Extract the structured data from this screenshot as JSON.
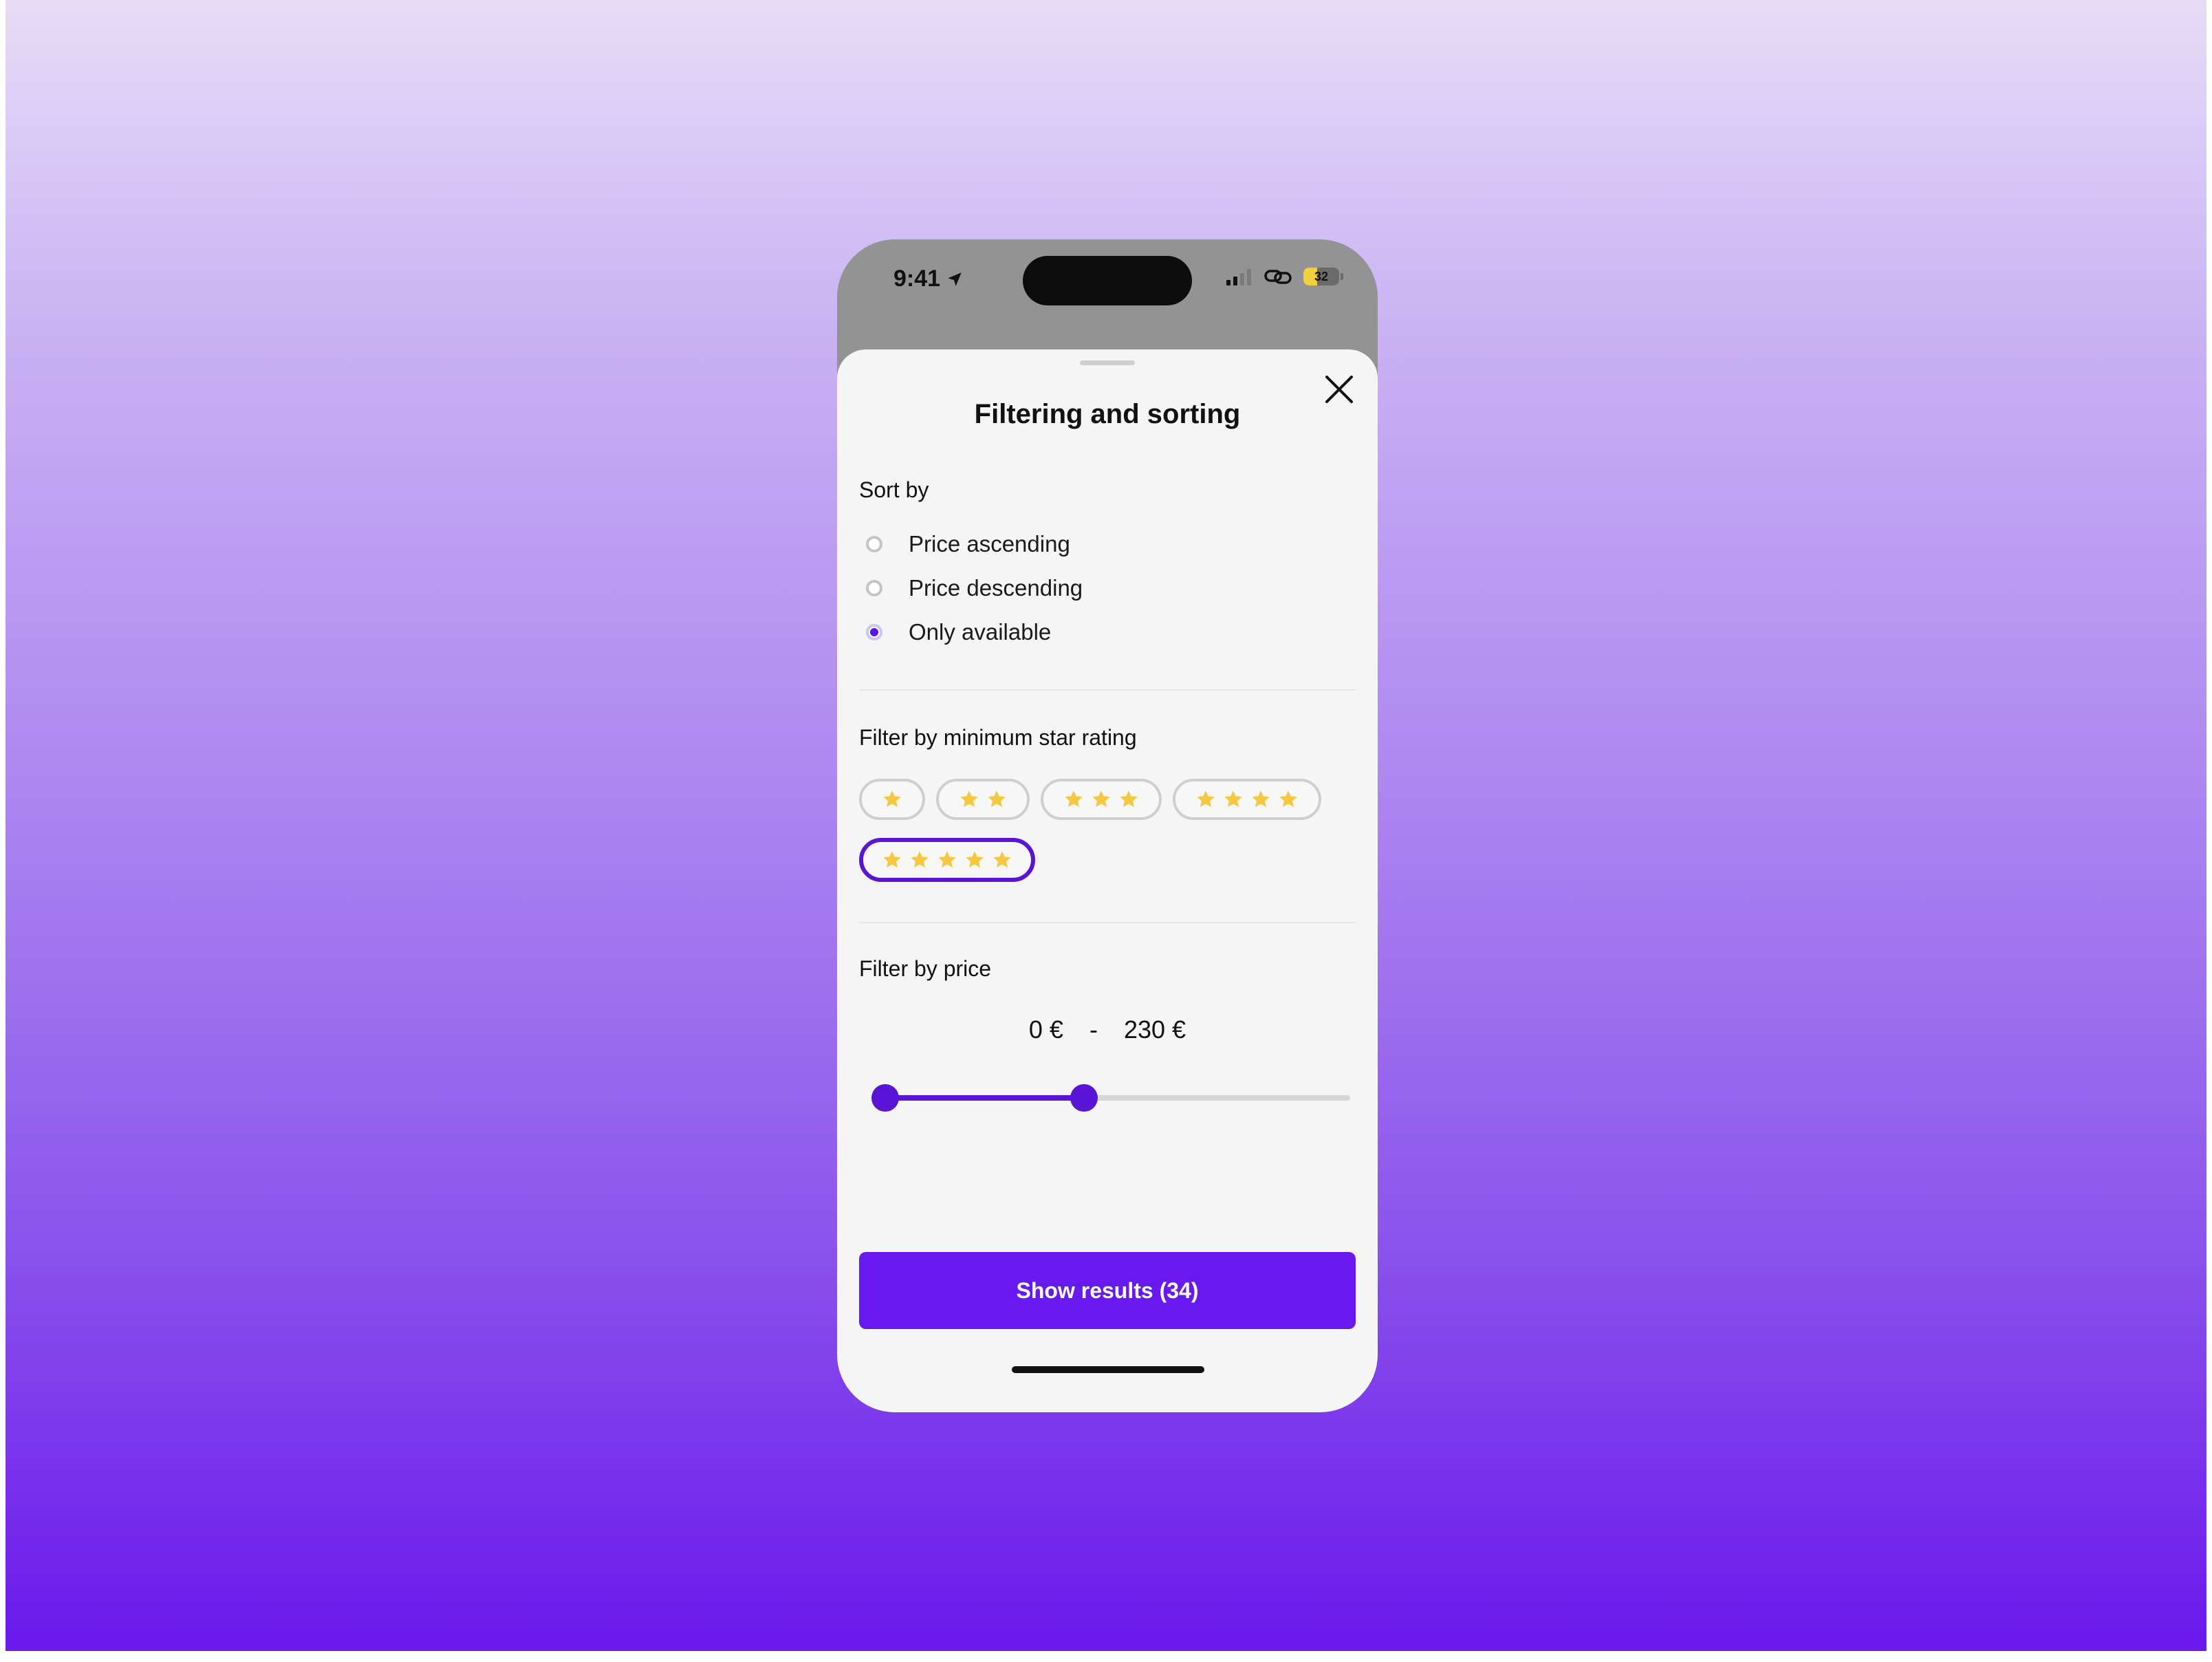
{
  "status_bar": {
    "time": "9:41",
    "battery": "32"
  },
  "sheet": {
    "title": "Filtering and sorting",
    "sort": {
      "label": "Sort by",
      "options": [
        {
          "label": "Price ascending",
          "checked": false
        },
        {
          "label": "Price descending",
          "checked": false
        },
        {
          "label": "Only available",
          "checked": true
        }
      ]
    },
    "rating": {
      "label": "Filter by minimum star rating",
      "chips": [
        {
          "stars": 1,
          "selected": false
        },
        {
          "stars": 2,
          "selected": false
        },
        {
          "stars": 3,
          "selected": false
        },
        {
          "stars": 4,
          "selected": false
        },
        {
          "stars": 5,
          "selected": true
        }
      ]
    },
    "price": {
      "label": "Filter by price",
      "min_label": "0 €",
      "separator": "-",
      "max_label": "230 €",
      "range_fraction_low": 0,
      "range_fraction_high": 0.44
    },
    "button_label": "Show results (34)"
  },
  "colors": {
    "accent": "#5a14d8",
    "button": "#6719ef",
    "star": "#f5c840"
  }
}
